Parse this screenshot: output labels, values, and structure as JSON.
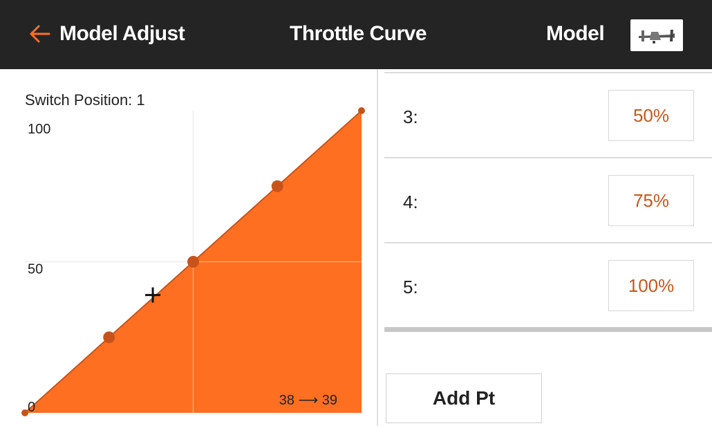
{
  "header": {
    "back_label": "Model Adjust",
    "title": "Throttle Curve",
    "model_label": "Model"
  },
  "graph": {
    "switch_position": "Switch Position: 1",
    "value_readout": "38 ⟶ 39"
  },
  "points": [
    {
      "label": "3:",
      "value": "50%"
    },
    {
      "label": "4:",
      "value": "75%"
    },
    {
      "label": "5:",
      "value": "100%"
    }
  ],
  "add_point_label": "Add Pt",
  "colors": {
    "header_bg": "#242424",
    "accent": "#ff6f22",
    "value_text": "#c9561c"
  },
  "chart_data": {
    "type": "area",
    "x": [
      0,
      25,
      50,
      75,
      100
    ],
    "y": [
      0,
      25,
      50,
      75,
      100
    ],
    "ylim": [
      0,
      100
    ],
    "xlim": [
      0,
      100
    ],
    "y_tick_labels": [
      "0",
      "50",
      "100"
    ],
    "cursor": {
      "x": 38,
      "y": 39
    }
  }
}
